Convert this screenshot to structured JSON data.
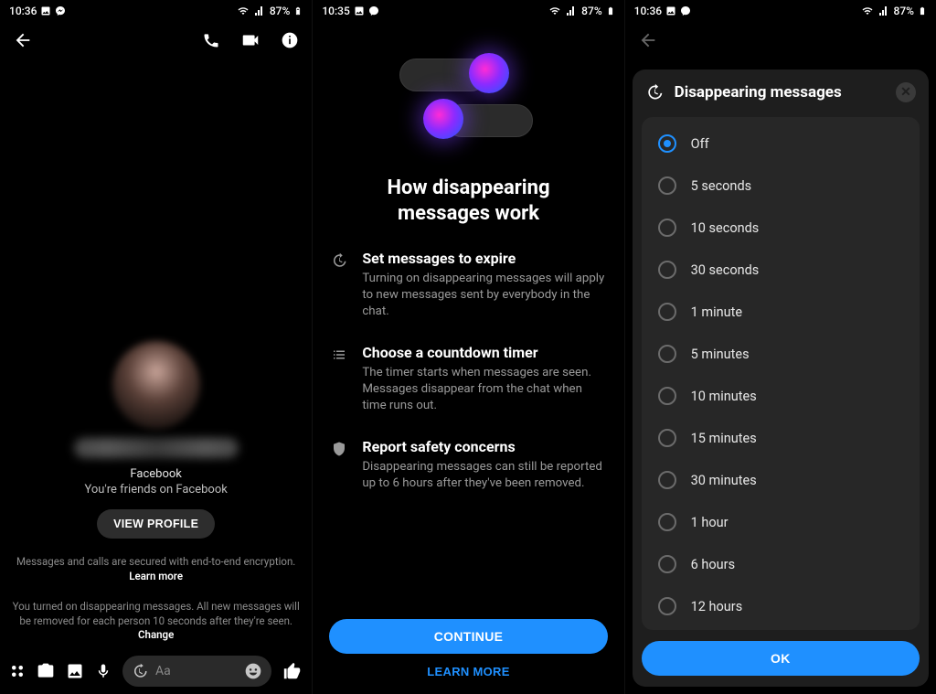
{
  "status": {
    "battery": "87%"
  },
  "s1": {
    "time": "10:36",
    "fb_label": "Facebook",
    "friends_label": "You're friends on Facebook",
    "view_profile": "VIEW PROFILE",
    "e2e_a": "Messages and calls are secured with end-to-end encryption. ",
    "e2e_link": "Learn more",
    "dm_a": "You turned on disappearing messages. All new messages will be removed for each person 10 seconds after they're seen. ",
    "dm_link": "Change",
    "composer_placeholder": "Aa"
  },
  "s2": {
    "time": "10:35",
    "title_a": "How disappearing",
    "title_b": "messages work",
    "items": [
      {
        "h": "Set messages to expire",
        "p": "Turning on disappearing messages will apply to new messages sent by everybody in the chat."
      },
      {
        "h": "Choose a countdown timer",
        "p": "The timer starts when messages are seen. Messages disappear from the chat when time runs out."
      },
      {
        "h": "Report safety concerns",
        "p": "Disappearing messages can still be reported up to 6 hours after they've been removed."
      }
    ],
    "continue": "CONTINUE",
    "learn_more": "LEARN MORE"
  },
  "s3": {
    "time": "10:36",
    "title": "Disappearing messages",
    "options": [
      "Off",
      "5 seconds",
      "10 seconds",
      "30 seconds",
      "1 minute",
      "5 minutes",
      "10 minutes",
      "15 minutes",
      "30 minutes",
      "1 hour",
      "6 hours",
      "12 hours"
    ],
    "selected_index": 0,
    "ok": "OK"
  }
}
